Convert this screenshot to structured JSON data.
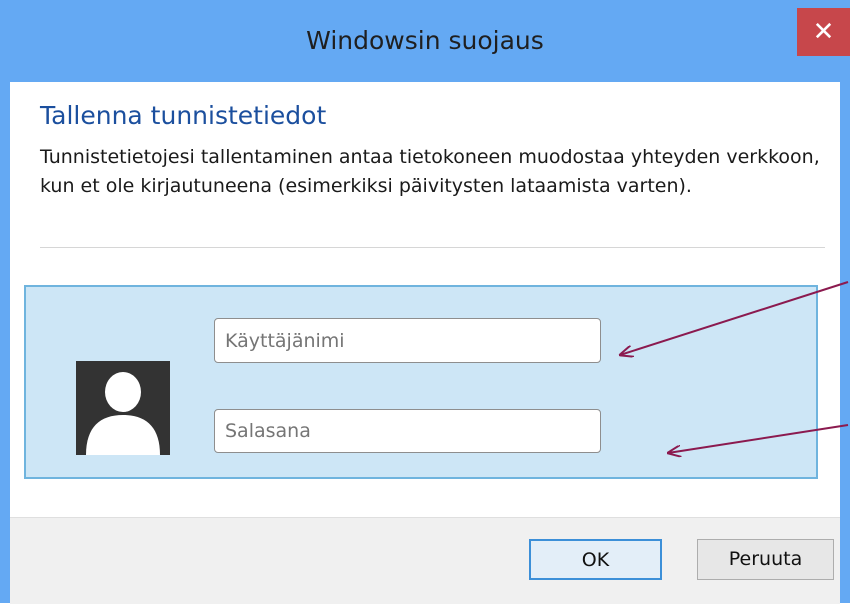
{
  "window": {
    "title": "Windowsin suojaus",
    "close_glyph": "✕"
  },
  "content": {
    "heading": "Tallenna tunnistetiedot",
    "description": "Tunnistetietojesi tallentaminen antaa tietokoneen muodostaa yhteyden verkkoon, kun et ole kirjautuneena (esimerkiksi päivitysten lataamista varten)."
  },
  "credentials": {
    "username_placeholder": "Käyttäjänimi",
    "password_placeholder": "Salasana"
  },
  "buttons": {
    "ok": "OK",
    "cancel": "Peruuta"
  },
  "annotations": {
    "arrow_color": "#8b1a4f"
  },
  "colors": {
    "titlebar": "#64a9f3",
    "close": "#c7474b",
    "heading": "#1b4f9e",
    "panel": "#cde6f6"
  }
}
